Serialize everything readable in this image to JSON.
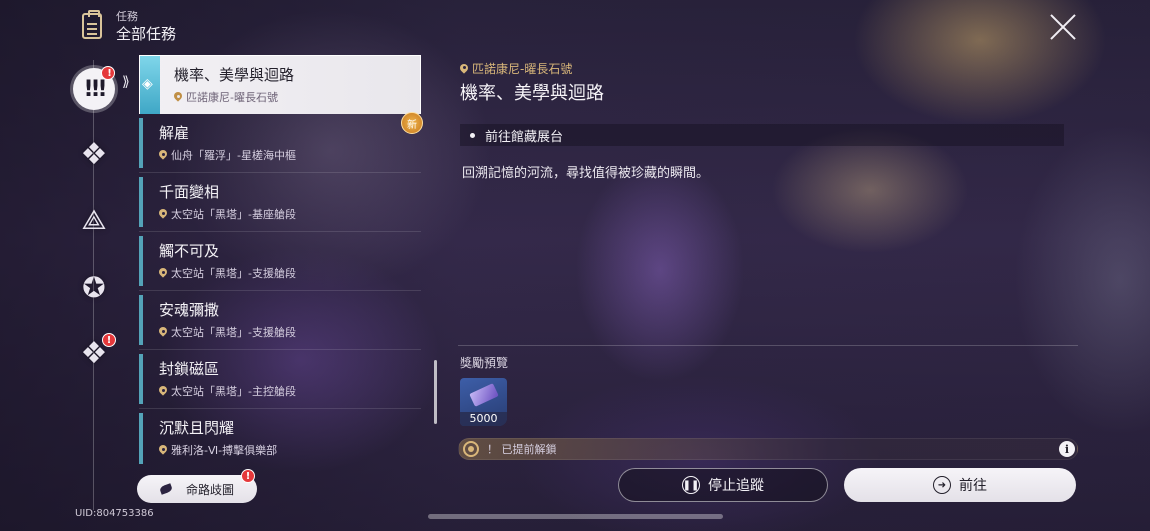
{
  "header": {
    "subtitle": "任務",
    "title": "全部任務"
  },
  "rail": {
    "active_glyph": "!!!",
    "badge": "!"
  },
  "quests": [
    {
      "title": "機率、美學與迴路",
      "location": "匹諾康尼-曜長石號",
      "active": true,
      "new": false
    },
    {
      "title": "解雇",
      "location": "仙舟「羅浮」-星槎海中樞",
      "active": false,
      "new": true,
      "new_label": "新"
    },
    {
      "title": "千面變相",
      "location": "太空站「黑塔」-基座艙段",
      "active": false,
      "new": false
    },
    {
      "title": "觸不可及",
      "location": "太空站「黑塔」-支援艙段",
      "active": false,
      "new": false
    },
    {
      "title": "安魂彌撒",
      "location": "太空站「黑塔」-支援艙段",
      "active": false,
      "new": false
    },
    {
      "title": "封鎖磁區",
      "location": "太空站「黑塔」-主控艙段",
      "active": false,
      "new": false
    },
    {
      "title": "沉默且閃耀",
      "location": "雅利洛-Ⅵ-搏擊俱樂部",
      "active": false,
      "new": false
    }
  ],
  "detail": {
    "location": "匹諾康尼-曜長石號",
    "title": "機率、美學與迴路",
    "objective": "前往館藏展台",
    "description": "回溯記憶的河流，尋找值得被珍藏的瞬間。",
    "reward_label": "獎勵預覽",
    "reward_qty": "5000",
    "unlock_text": "！ 已提前解鎖",
    "info_glyph": "i"
  },
  "buttons": {
    "stop_tracking": "停止追蹤",
    "go": "前往",
    "branch": "命路歧圖"
  },
  "uid": "UID:804753386",
  "colors": {
    "accent_gold": "#d9b77a",
    "quest_bar": "#54a3b8",
    "badge_red": "#e5383b"
  }
}
